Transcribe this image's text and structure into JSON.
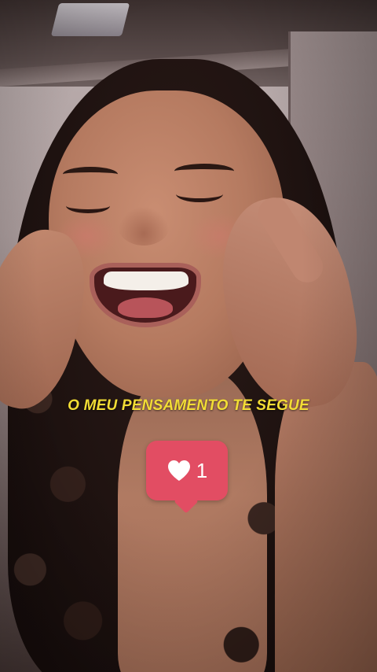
{
  "video": {
    "caption": "O MEU PENSAMENTO TE SEGUE"
  },
  "like_notification": {
    "icon": "heart-icon",
    "count": "1",
    "color": "#e24d63"
  },
  "colors": {
    "caption_text": "#f2dd35"
  }
}
